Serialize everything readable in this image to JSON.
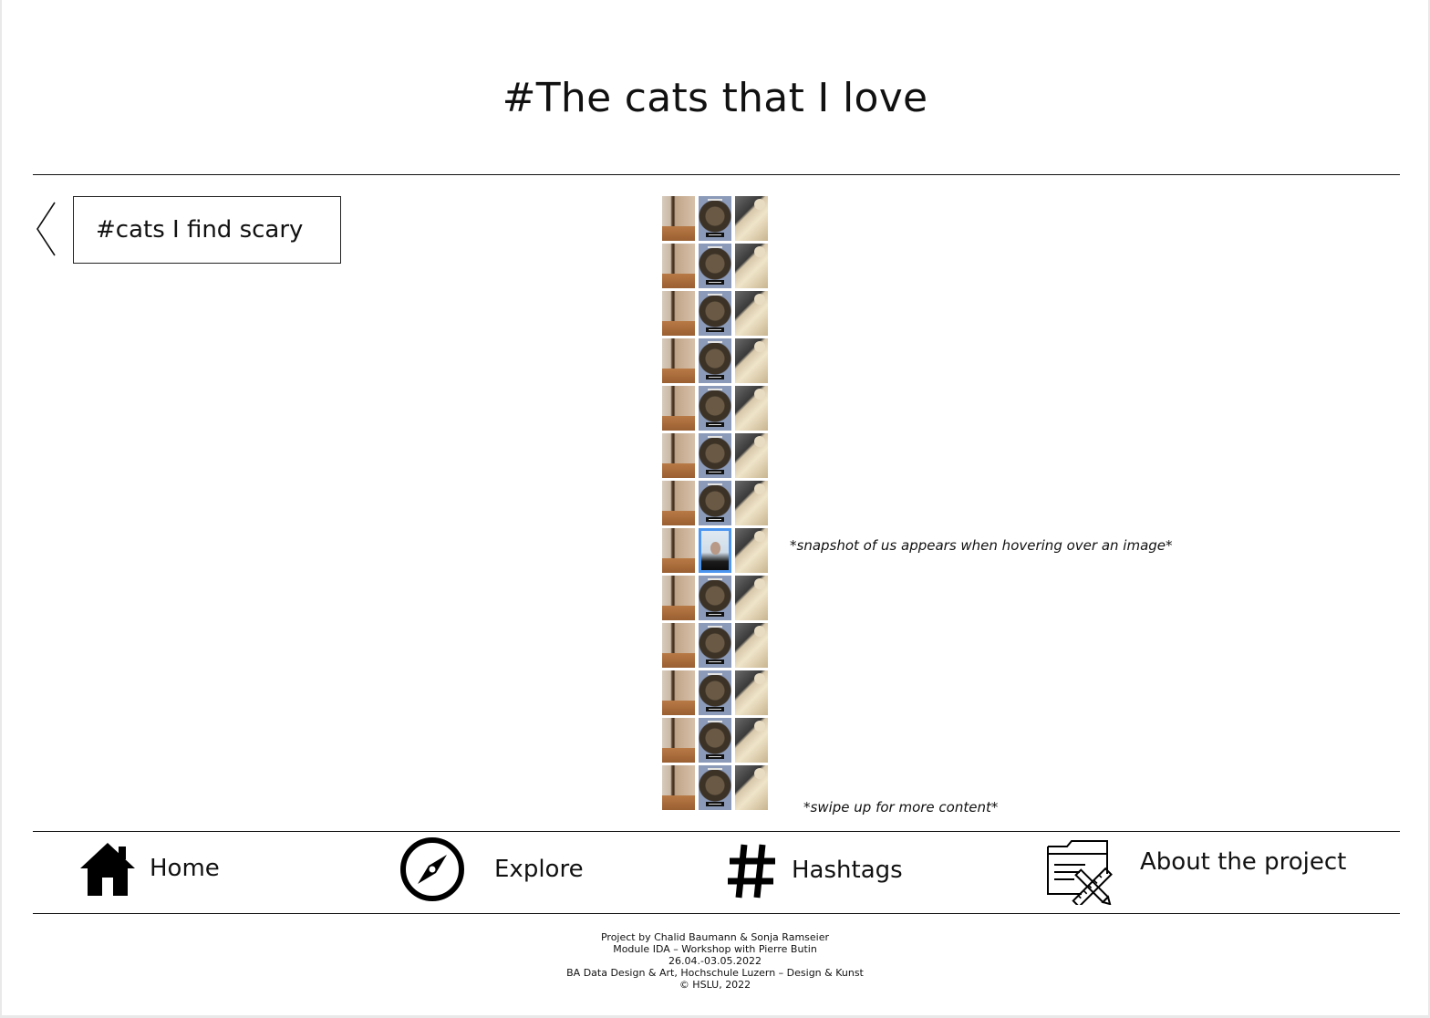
{
  "header": {
    "title": "#The cats that I love"
  },
  "filter": {
    "back_icon": "chevron-left-icon",
    "tag": "#cats I find scary"
  },
  "gallery": {
    "rows": 13,
    "columns": 3,
    "hover_row": 8,
    "hover_column": 2,
    "hover_note": "*snapshot of us  appears when hovering over an image*",
    "swipe_note": "*swipe up for more content*"
  },
  "nav": {
    "items": [
      {
        "icon": "home-icon",
        "label": "Home"
      },
      {
        "icon": "compass-icon",
        "label": "Explore"
      },
      {
        "icon": "hashtag-icon",
        "label": "Hashtags"
      },
      {
        "icon": "project-folder-icon",
        "label": "About the project"
      }
    ]
  },
  "footer": {
    "lines": [
      "Project by Chalid Baumann & Sonja Ramseier",
      "Module IDA – Workshop with Pierre Butin",
      "26.04.-03.05.2022",
      "BA Data Design & Art, Hochschule Luzern – Design & Kunst",
      "© HSLU, 2022"
    ]
  },
  "colors": {
    "hover_border": "#4d96f0",
    "rule": "#111111"
  }
}
